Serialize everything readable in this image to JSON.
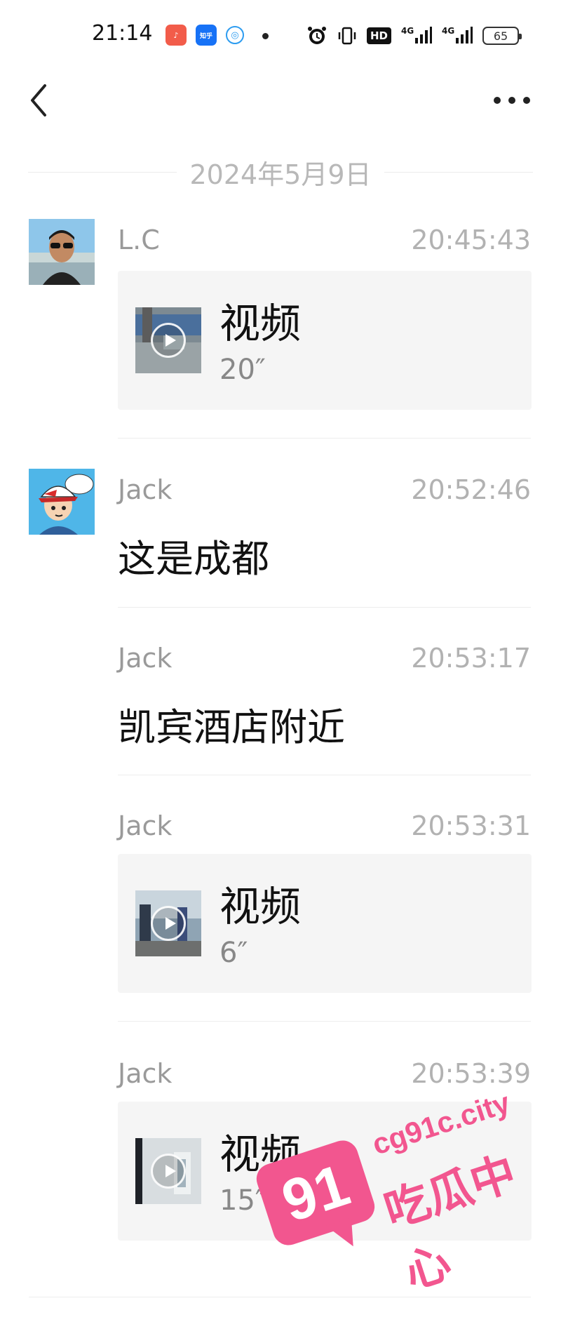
{
  "status_bar": {
    "time": "21:14",
    "apps": [
      "music-app-icon",
      "zhihu-app-icon",
      "qq-browser-icon"
    ],
    "zhihu_label": "知乎",
    "hd_label": "HD",
    "net1": "4G",
    "net2": "4G",
    "battery": "65"
  },
  "header": {
    "back_icon": "chevron-left-icon",
    "more_icon": "more-dots-icon"
  },
  "date_separator": "2024年5月9日",
  "messages": [
    {
      "sender": "L.C",
      "time": "20:45:43",
      "type": "video",
      "label": "视频",
      "duration": "20″"
    },
    {
      "sender": "Jack",
      "time": "20:52:46",
      "type": "text",
      "text": "这是成都"
    },
    {
      "sender": "Jack",
      "time": "20:53:17",
      "type": "text",
      "text": "凯宾酒店附近"
    },
    {
      "sender": "Jack",
      "time": "20:53:31",
      "type": "video",
      "label": "视频",
      "duration": "6″"
    },
    {
      "sender": "Jack",
      "time": "20:53:39",
      "type": "video",
      "label": "视频",
      "duration": "15″"
    }
  ],
  "watermark": {
    "number": "91",
    "url": "cg91c.city",
    "text": "吃瓜中心"
  },
  "colors": {
    "background": "#ffffff",
    "card": "#f5f5f5",
    "watermark": "#f2568f"
  }
}
